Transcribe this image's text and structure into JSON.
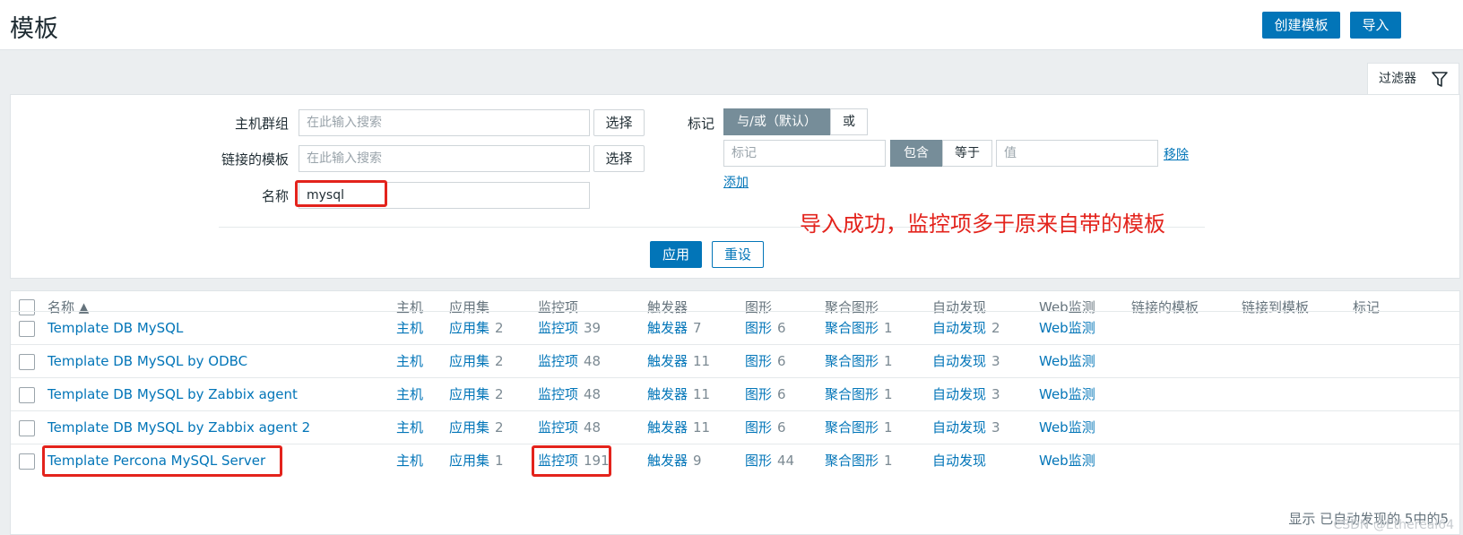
{
  "header": {
    "title": "模板",
    "create_button": "创建模板",
    "import_button": "导入"
  },
  "filter": {
    "tab_label": "过滤器",
    "host_group_label": "主机群组",
    "host_group_placeholder": "在此输入搜索",
    "linked_template_label": "链接的模板",
    "linked_template_placeholder": "在此输入搜索",
    "select_label": "选择",
    "name_label": "名称",
    "name_value": "mysql",
    "tags_label": "标记",
    "tag_mode_and_or": "与/或（默认）",
    "tag_mode_or": "或",
    "tag_placeholder": "标记",
    "op_contains": "包含",
    "op_equals": "等于",
    "value_placeholder": "值",
    "remove_label": "移除",
    "add_label": "添加",
    "apply_label": "应用",
    "reset_label": "重设"
  },
  "annotation": "导入成功，监控项多于原来自带的模板",
  "table": {
    "headers": {
      "name": "名称 ▲",
      "hosts": "主机",
      "applications": "应用集",
      "items": "监控项",
      "triggers": "触发器",
      "graphs": "图形",
      "screens": "聚合图形",
      "discovery": "自动发现",
      "web": "Web监测",
      "linked_templates": "链接的模板",
      "linked_to_templates": "链接到模板",
      "tags": "标记"
    },
    "rows": [
      {
        "name": "Template DB MySQL",
        "hosts": "主机",
        "applications": "应用集",
        "applications_count": "2",
        "items": "监控项",
        "items_count": "39",
        "triggers": "触发器",
        "triggers_count": "7",
        "graphs": "图形",
        "graphs_count": "6",
        "screens": "聚合图形",
        "screens_count": "1",
        "discovery": "自动发现",
        "discovery_count": "2",
        "web": "Web监测"
      },
      {
        "name": "Template DB MySQL by ODBC",
        "hosts": "主机",
        "applications": "应用集",
        "applications_count": "2",
        "items": "监控项",
        "items_count": "48",
        "triggers": "触发器",
        "triggers_count": "11",
        "graphs": "图形",
        "graphs_count": "6",
        "screens": "聚合图形",
        "screens_count": "1",
        "discovery": "自动发现",
        "discovery_count": "3",
        "web": "Web监测"
      },
      {
        "name": "Template DB MySQL by Zabbix agent",
        "hosts": "主机",
        "applications": "应用集",
        "applications_count": "2",
        "items": "监控项",
        "items_count": "48",
        "triggers": "触发器",
        "triggers_count": "11",
        "graphs": "图形",
        "graphs_count": "6",
        "screens": "聚合图形",
        "screens_count": "1",
        "discovery": "自动发现",
        "discovery_count": "3",
        "web": "Web监测"
      },
      {
        "name": "Template DB MySQL by Zabbix agent 2",
        "hosts": "主机",
        "applications": "应用集",
        "applications_count": "2",
        "items": "监控项",
        "items_count": "48",
        "triggers": "触发器",
        "triggers_count": "11",
        "graphs": "图形",
        "graphs_count": "6",
        "screens": "聚合图形",
        "screens_count": "1",
        "discovery": "自动发现",
        "discovery_count": "3",
        "web": "Web监测"
      },
      {
        "name": "Template Percona MySQL Server",
        "hosts": "主机",
        "applications": "应用集",
        "applications_count": "1",
        "items": "监控项",
        "items_count": "191",
        "triggers": "触发器",
        "triggers_count": "9",
        "graphs": "图形",
        "graphs_count": "44",
        "screens": "聚合图形",
        "screens_count": "1",
        "discovery": "自动发现",
        "discovery_count": "",
        "web": "Web监测"
      }
    ],
    "footer": "显示 已自动发现的 5中的5"
  },
  "watermark": "CSDN @Ethereal64",
  "colors": {
    "primary": "#0275b8",
    "annotation_red": "#e3231c",
    "segment_active": "#768d99"
  }
}
